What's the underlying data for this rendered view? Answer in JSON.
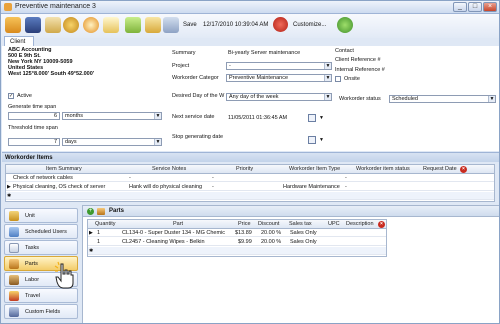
{
  "window": {
    "title": "Preventive maintenance 3",
    "controls": [
      "_",
      "□",
      "×"
    ]
  },
  "toolbar": {
    "save_label": "Save",
    "datetime": "12/17/2010 10:39:04 AM",
    "customize_label": "Customize..."
  },
  "tabs": [
    {
      "label": "Client"
    }
  ],
  "client": {
    "name": "ABC Accounting",
    "address1": "500 E 9th St.",
    "address2": "New York NY 10009-5059",
    "country": "United States",
    "coords": "West 125°8.000' South 49°52.000'",
    "active_label": "Active",
    "active_checked": true
  },
  "generate": {
    "label": "Generate time span",
    "value": "6",
    "unit": "months"
  },
  "threshold": {
    "label": "Threshold time span",
    "value": "7",
    "unit": "days"
  },
  "summary": {
    "label": "Summary",
    "value": "Bi-yearly Server maintenance",
    "project_label": "Project",
    "project_value": "-",
    "category_label": "Workorder Categor",
    "category_value": "Preventive Maintenance",
    "desired_day_label": "Desired Day of the W",
    "desired_day_value": "Any day of the week",
    "next_service_label": "Next service date",
    "next_service_value": "11/05/2011 01:36:45 AM",
    "stop_label": "Stop generating date"
  },
  "contact": {
    "contact_label": "Contact",
    "client_ref_label": "Client Reference #",
    "internal_ref_label": "Internal Reference #",
    "onsite_label": "Onsite",
    "onsite_checked": false,
    "status_label": "Workorder status",
    "status_value": "Scheduled"
  },
  "workorder_items": {
    "section_label": "Workorder Items",
    "columns": [
      "Item Summary",
      "Service Notes",
      "Priority",
      "Workorder Item Type",
      "Workorder item status",
      "Request Date"
    ],
    "rows": [
      {
        "summary": "Check of network cables",
        "notes": "-",
        "priority": "-",
        "type": "",
        "status": "-",
        "date": ""
      },
      {
        "summary": "Physical cleaning, OS check of server",
        "notes": "Hank will do physical cleaning",
        "priority": "-",
        "type": "Hardware Maintenance",
        "status": "-",
        "date": ""
      }
    ]
  },
  "sidebar": {
    "items": [
      {
        "label": "Unit"
      },
      {
        "label": "Scheduled Users"
      },
      {
        "label": "Tasks"
      },
      {
        "label": "Parts"
      },
      {
        "label": "Labor"
      },
      {
        "label": "Travel"
      },
      {
        "label": "Custom Fields"
      }
    ]
  },
  "parts": {
    "title": "Parts",
    "columns": [
      "Quantity",
      "Part",
      "Price",
      "Discount",
      "Sales tax",
      "UPC",
      "Description"
    ],
    "rows": [
      {
        "qty": "1",
        "part": "CL134-0 - Super Duster 134 - MG Chemic",
        "price": "$13.89",
        "discount": "20.00 %",
        "tax": "Sales Only",
        "upc": "",
        "desc": ""
      },
      {
        "qty": "1",
        "part": "CL2457 - Cleaning Wipes - Belkin",
        "price": "$9.99",
        "discount": "20.00 %",
        "tax": "Sales Only",
        "upc": "",
        "desc": ""
      }
    ]
  },
  "colors": {
    "accent": "#c92b1f",
    "panel_bg": "#dfe8f5",
    "active_item": "#f3cc6a"
  }
}
